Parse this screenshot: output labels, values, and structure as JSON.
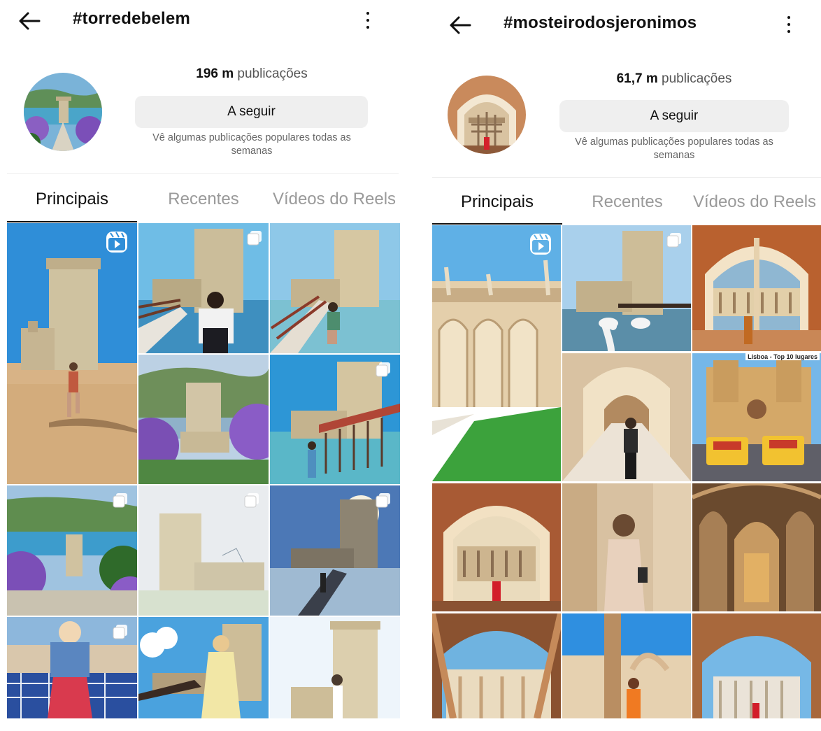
{
  "left": {
    "hashtag": "#torredebelem",
    "posts_count": "196 m",
    "posts_word": "publicações",
    "follow_label": "A seguir",
    "hint": "Vê algumas publicações populares todas as semanas",
    "tabs": [
      "Principais",
      "Recentes",
      "Vídeos do Reels"
    ],
    "active_tab": "Principais"
  },
  "right": {
    "hashtag": "#mosteirodosjeronimos",
    "posts_count": "61,7 m",
    "posts_word": "publicações",
    "follow_label": "A seguir",
    "hint": "Vê algumas publicações populares todas as semanas",
    "tabs": [
      "Principais",
      "Recentes",
      "Vídeos do Reels"
    ],
    "active_tab": "Principais",
    "tile_caption": "Lisboa - Top 10 lugares"
  },
  "icons": {
    "back": "arrow-left-icon",
    "more": "more-vertical-icon",
    "reel": "reels-icon",
    "multi": "multiple-photos-icon"
  },
  "colors": {
    "follow_bg": "#efefef",
    "inactive_tab": "#9a9a9a",
    "active_tab": "#111111"
  }
}
